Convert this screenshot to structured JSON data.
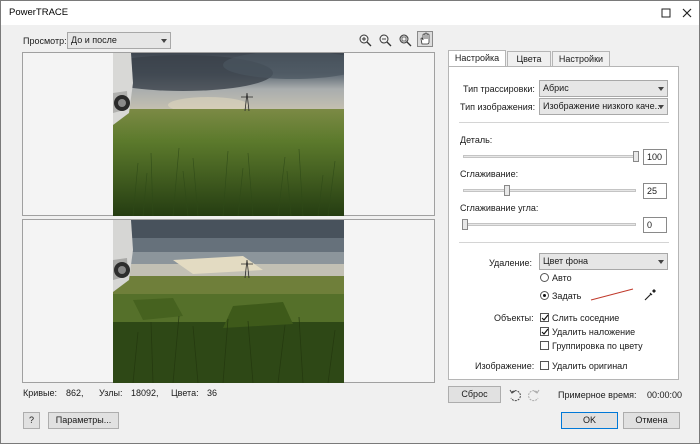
{
  "window": {
    "title": "PowerTRACE"
  },
  "preview": {
    "label": "Просмотр:",
    "mode": "До и после"
  },
  "stats": {
    "curves_label": "Кривые:",
    "curves": "862,",
    "nodes_label": "Узлы:",
    "nodes": "18092,",
    "colors_label": "Цвета:",
    "colors": "36"
  },
  "tabs": [
    "Настройка",
    "Цвета",
    "Настройки"
  ],
  "settings": {
    "trace_type_label": "Тип трассировки:",
    "trace_type": "Абрис",
    "image_type_label": "Тип изображения:",
    "image_type": "Изображение низкого каче...",
    "detail_label": "Деталь:",
    "detail_value": "100",
    "detail_level": 1.0,
    "smoothing_label": "Сглаживание:",
    "smoothing_value": "25",
    "smoothing_level": 0.25,
    "corner_label": "Сглаживание угла:",
    "corner_value": "0",
    "corner_level": 0.0,
    "remove_label": "Удаление:",
    "remove_value": "Цвет фона",
    "radio_auto": "Авто",
    "radio_set": "Задать",
    "objects_label": "Объекты:",
    "merge_adjacent": "Слить соседние",
    "remove_overlap": "Удалить наложение",
    "group_by_color": "Группировка по цвету",
    "image_label": "Изображение:",
    "delete_original": "Удалить оригинал"
  },
  "footer": {
    "reset": "Сброс",
    "estimated_time_label": "Примерное время:",
    "estimated_time": "00:00:00",
    "help": "?",
    "params": "Параметры...",
    "ok": "OK",
    "cancel": "Отмена"
  },
  "colors": {
    "accent": "#0078d7",
    "swatch_line": "#c0392b"
  }
}
